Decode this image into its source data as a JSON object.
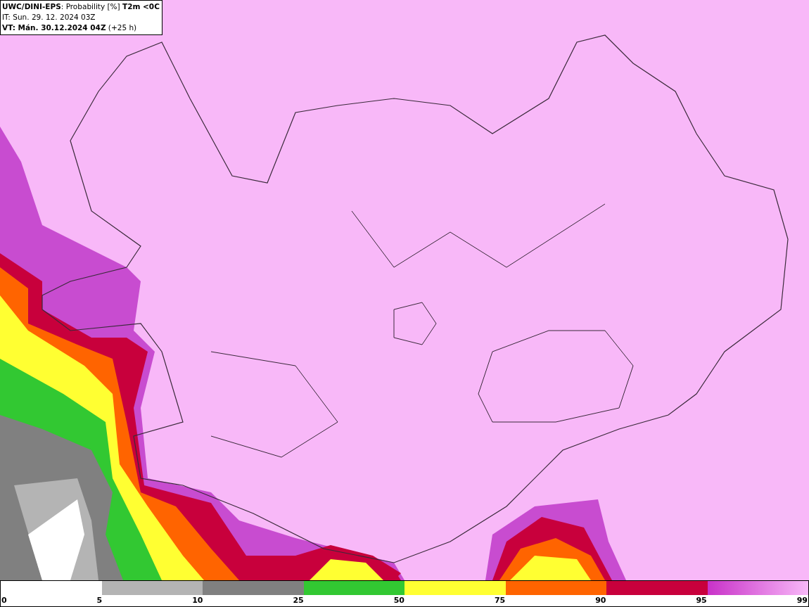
{
  "header": {
    "lines": [
      "**UWC/DINI-EPS**: Probability [%] **T2m <0C**",
      "IT: Sun. 29. 12. 2024 03Z",
      "**VT: Mán. 30.12.2024 04Z** (+25 h)"
    ]
  },
  "legend": {
    "bins": [
      {
        "kind": "blank"
      },
      {
        "color": "#b4b4b4"
      },
      {
        "color": "#808080"
      },
      {
        "color": "#32c832"
      },
      {
        "color": "#ffff32"
      },
      {
        "color": "#ff6400"
      },
      {
        "color": "#c8003c"
      },
      {
        "kind": "gradient"
      }
    ],
    "labels": [
      "0",
      "5",
      "10",
      "25",
      "50",
      "75",
      "90",
      "95",
      "99"
    ]
  }
}
